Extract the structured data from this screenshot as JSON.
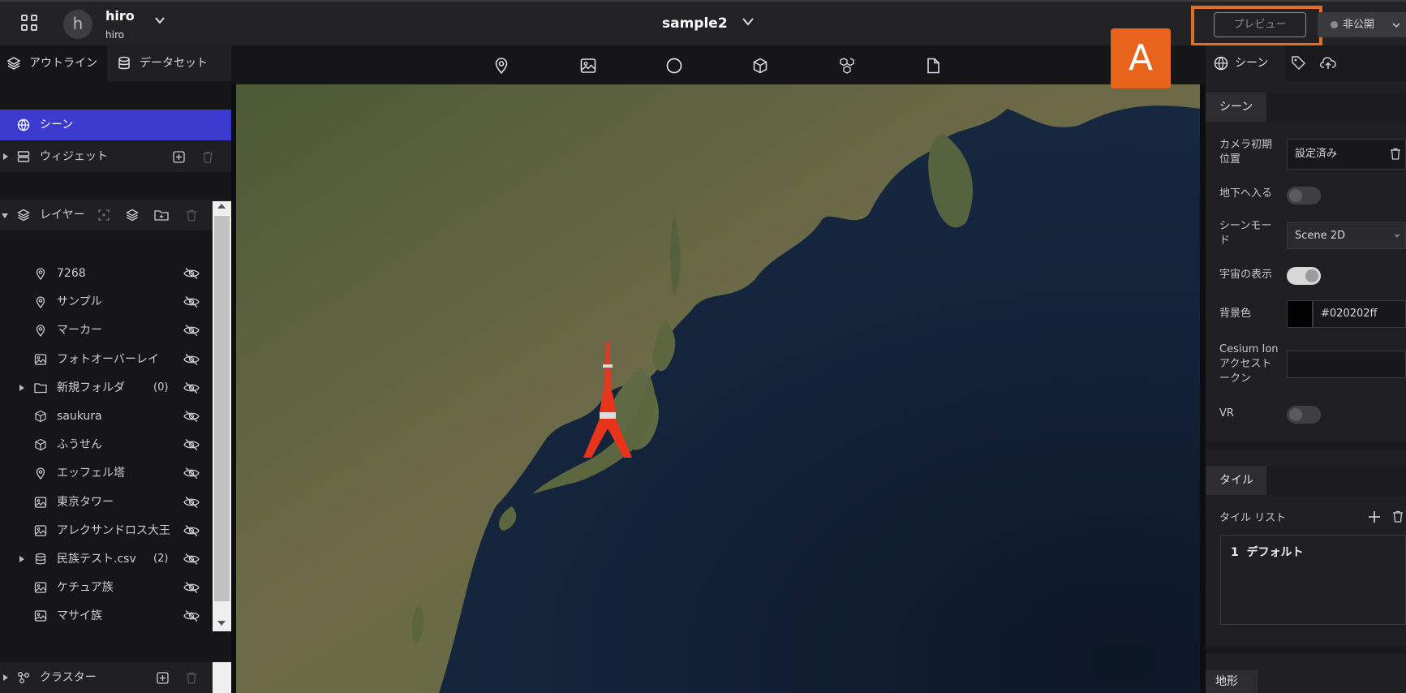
{
  "header": {
    "avatar_letter": "h",
    "user_name": "hiro",
    "user_sub": "hiro",
    "project_title": "sample2",
    "preview_label": "プレビュー",
    "publish_label": "非公開",
    "annotation_badge": "A",
    "highlight_color": "#e46e1f"
  },
  "left": {
    "tabs": [
      "アウトライン",
      "データセット"
    ],
    "scene_label": "シーン",
    "widget_label": "ウィジェット",
    "layers_label": "レイヤー",
    "layers": [
      {
        "label": "7268",
        "icon": "pin-icon"
      },
      {
        "label": "サンプル",
        "icon": "pin-icon"
      },
      {
        "label": "マーカー",
        "icon": "pin-icon"
      },
      {
        "label": "フォトオーバーレイ",
        "icon": "image-icon"
      },
      {
        "label": "新規フォルダ",
        "icon": "folder-icon",
        "count": "(0)"
      },
      {
        "label": "saukura",
        "icon": "model-icon"
      },
      {
        "label": "ふうせん",
        "icon": "model-icon"
      },
      {
        "label": "エッフェル塔",
        "icon": "pin-icon"
      },
      {
        "label": "東京タワー",
        "icon": "image-icon"
      },
      {
        "label": "アレクサンドロス大王",
        "icon": "image-icon"
      },
      {
        "label": "民族テスト.csv",
        "icon": "database-icon",
        "count": "(2)"
      },
      {
        "label": "ケチュア族",
        "icon": "image-icon"
      },
      {
        "label": "マサイ族",
        "icon": "image-icon"
      }
    ],
    "cluster_label": "クラスター",
    "selected_color": "#3b3bcf"
  },
  "toolbar": {
    "tools": [
      "pin-icon",
      "image-icon",
      "circle-icon",
      "cube-icon",
      "cluster-cubes-icon",
      "file-icon"
    ]
  },
  "right": {
    "tab_label": "シーン",
    "scene_section": "シーン",
    "camera_label_1": "カメラ初期",
    "camera_label_2": "位置",
    "camera_value": "設定済み",
    "underground_label": "地下へ入る",
    "scene_mode_label_1": "シーンモー",
    "scene_mode_label_2": "ド",
    "scene_mode_value": "Scene 2D",
    "space_label": "宇宙の表示",
    "bg_label": "背景色",
    "bg_value": "#020202ff",
    "ion_label_1": "Cesium Ion",
    "ion_label_2": "アクセスト",
    "ion_label_3": "ークン",
    "ion_value": "",
    "vr_label": "VR",
    "tile_section": "タイル",
    "tile_list_label": "タイル リスト",
    "tile_item_index": "1",
    "tile_item_label": "デフォルト",
    "terrain_section": "地形",
    "underground_on": false,
    "space_on": true,
    "vr_on": false
  }
}
